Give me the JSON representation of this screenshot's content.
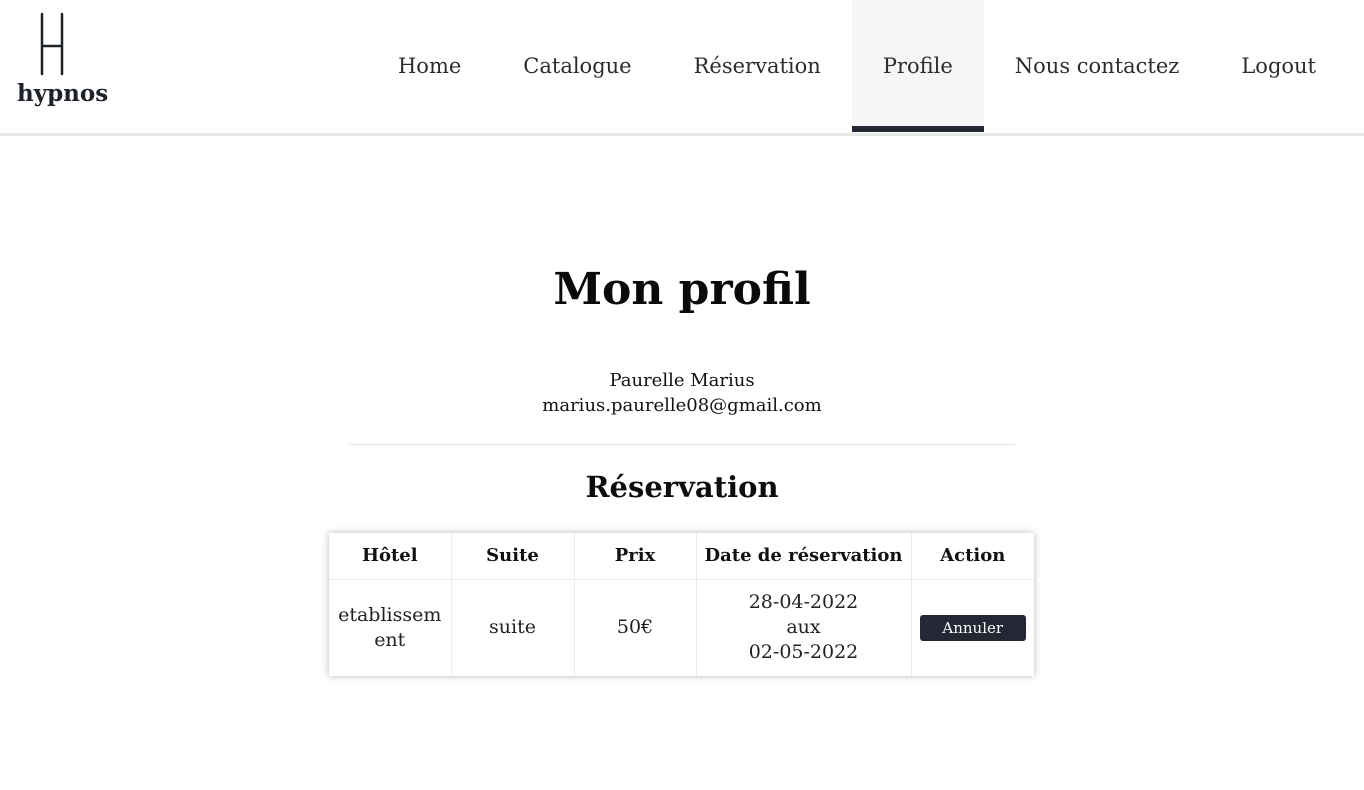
{
  "brand": {
    "name": "hypnos",
    "logo_letter": "H"
  },
  "nav": {
    "items": [
      {
        "label": "Home"
      },
      {
        "label": "Catalogue"
      },
      {
        "label": "Réservation"
      },
      {
        "label": "Profile",
        "active": true
      },
      {
        "label": "Nous contactez"
      },
      {
        "label": "Logout"
      }
    ]
  },
  "page": {
    "title": "Mon profil",
    "user_name": "Paurelle Marius",
    "user_email": "marius.paurelle08@gmail.com",
    "section_title": "Réservation"
  },
  "table": {
    "headers": [
      "Hôtel",
      "Suite",
      "Prix",
      "Date de réservation",
      "Action"
    ],
    "rows": [
      {
        "hotel": "etablissement",
        "suite": "suite",
        "price": "50€",
        "date_start": "28-04-2022",
        "date_sep": "aux",
        "date_end": "02-05-2022",
        "action_label": "Annuler"
      }
    ]
  },
  "colors": {
    "accent": "#232834",
    "active_bg": "#f6f6f6",
    "divider": "#e4e4e4"
  }
}
